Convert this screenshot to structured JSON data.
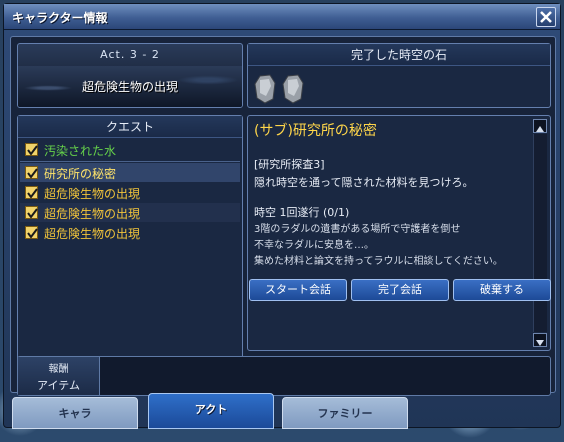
{
  "window": {
    "title": "キャラクター情報"
  },
  "act": {
    "title": "Act. 3 - 2",
    "subtitle": "超危険生物の出現"
  },
  "stones": {
    "header": "完了した時空の石",
    "icons": [
      "stone-icon",
      "stone-icon"
    ]
  },
  "quests": {
    "header": "クエスト",
    "items": [
      {
        "label": "汚染された水",
        "state": "done"
      },
      {
        "label": "研究所の秘密",
        "state": "selected"
      },
      {
        "label": "超危険生物の出現",
        "state": "normal"
      },
      {
        "label": "超危険生物の出現",
        "state": "normal"
      },
      {
        "label": "超危険生物の出現",
        "state": "normal"
      }
    ]
  },
  "detail": {
    "title": "(サブ)研究所の秘密",
    "section": "[研究所探査3]",
    "description": "隠れ時空を通って隠された材料を見つけろ。",
    "progress": "時空 1回遂行 (0/1)",
    "lines": [
      "3階のラダルの遺書がある場所で守護者を倒せ",
      "不幸なラダルに安息を…。",
      "集めた材料と論文を持ってラウルに相談してください。"
    ],
    "buttons": {
      "start": "スタート会話",
      "complete": "完了会話",
      "abandon": "破棄する"
    }
  },
  "reward": {
    "label_line1": "報酬",
    "label_line2": "アイテム"
  },
  "tabs": [
    {
      "label": "キャラ",
      "active": false
    },
    {
      "label": "アクト",
      "active": true
    },
    {
      "label": "ファミリー",
      "active": false
    }
  ],
  "colors": {
    "quest_done": "#66d24a",
    "quest_normal": "#f1c43a",
    "title_gold": "#ffd64a",
    "button_blue": "#2a5fb5"
  }
}
